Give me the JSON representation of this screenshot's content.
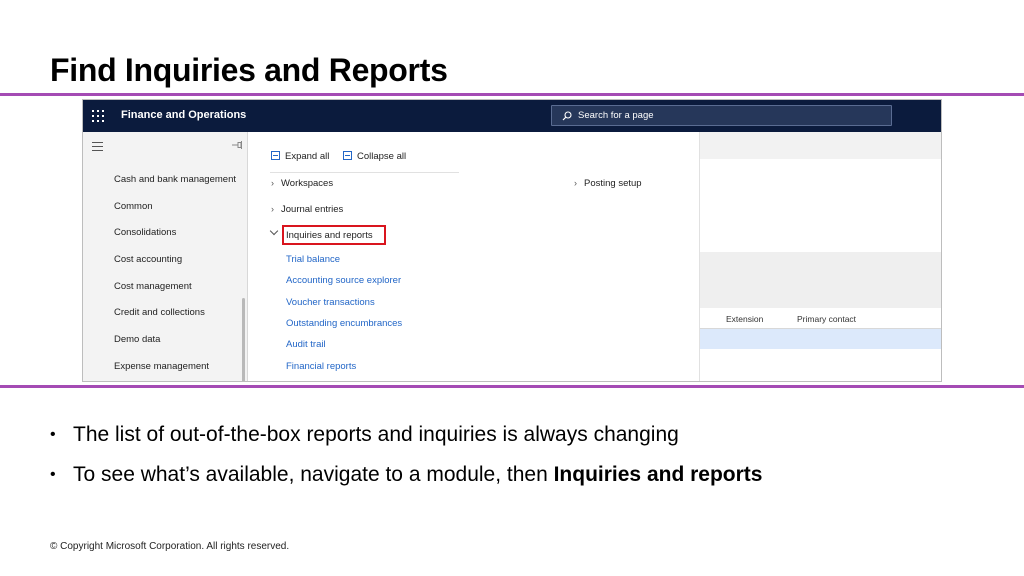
{
  "slide": {
    "title": "Find Inquiries and Reports",
    "bullets": [
      {
        "text": "The list of out-of-the-box reports and inquiries is always changing"
      },
      {
        "text": "To see what’s available, navigate to a module, then ",
        "bold": "Inquiries and reports"
      }
    ],
    "copyright": "© Copyright Microsoft Corporation. All rights reserved.",
    "accent_color": "#a44bb4"
  },
  "app": {
    "title": "Finance and Operations",
    "search_placeholder": "Search for a page",
    "navbar_color": "#0b1b3d"
  },
  "sidebar": {
    "items": [
      {
        "label": "Cash and bank management"
      },
      {
        "label": "Common"
      },
      {
        "label": "Consolidations"
      },
      {
        "label": "Cost accounting"
      },
      {
        "label": "Cost management"
      },
      {
        "label": "Credit and collections"
      },
      {
        "label": "Demo data"
      },
      {
        "label": "Expense management"
      }
    ]
  },
  "menu": {
    "expand_all": "Expand all",
    "collapse_all": "Collapse all",
    "groups": [
      {
        "label": "Workspaces",
        "state": "collapsed"
      },
      {
        "label": "Journal entries",
        "state": "collapsed"
      },
      {
        "label": "Inquiries and reports",
        "state": "expanded",
        "highlighted": true
      },
      {
        "label": "Posting setup",
        "state": "collapsed"
      }
    ],
    "links": [
      {
        "label": "Trial balance"
      },
      {
        "label": "Accounting source explorer"
      },
      {
        "label": "Voucher transactions"
      },
      {
        "label": "Outstanding encumbrances"
      },
      {
        "label": "Audit trail"
      },
      {
        "label": "Financial reports"
      }
    ],
    "link_color": "#2266c7",
    "highlight_color": "#d9151e"
  },
  "background_grid": {
    "columns": [
      "Extension",
      "Primary contact"
    ]
  }
}
